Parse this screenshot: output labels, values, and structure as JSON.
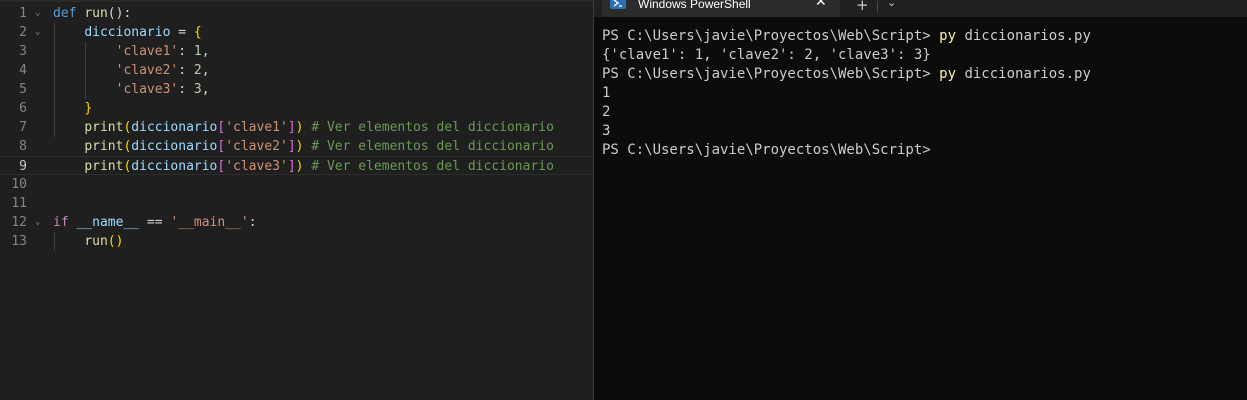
{
  "editor": {
    "lines": [
      {
        "n": "1",
        "t": [
          [
            "kw",
            "def "
          ],
          [
            "fn",
            "run"
          ],
          [
            "pn",
            "():"
          ]
        ]
      },
      {
        "n": "2",
        "t": [
          [
            "pn",
            "    "
          ],
          [
            "var",
            "diccionario"
          ],
          [
            "pn",
            " = "
          ],
          [
            "b1",
            "{"
          ]
        ]
      },
      {
        "n": "3",
        "t": [
          [
            "pn",
            "        "
          ],
          [
            "str",
            "'clave1'"
          ],
          [
            "pn",
            ": "
          ],
          [
            "num",
            "1"
          ],
          [
            "pn",
            ","
          ]
        ]
      },
      {
        "n": "4",
        "t": [
          [
            "pn",
            "        "
          ],
          [
            "str",
            "'clave2'"
          ],
          [
            "pn",
            ": "
          ],
          [
            "num",
            "2"
          ],
          [
            "pn",
            ","
          ]
        ]
      },
      {
        "n": "5",
        "t": [
          [
            "pn",
            "        "
          ],
          [
            "str",
            "'clave3'"
          ],
          [
            "pn",
            ": "
          ],
          [
            "num",
            "3"
          ],
          [
            "pn",
            ","
          ]
        ]
      },
      {
        "n": "6",
        "t": [
          [
            "pn",
            "    "
          ],
          [
            "b1",
            "}"
          ]
        ]
      },
      {
        "n": "7",
        "t": [
          [
            "pn",
            "    "
          ],
          [
            "fn",
            "print"
          ],
          [
            "b1",
            "("
          ],
          [
            "var",
            "diccionario"
          ],
          [
            "b2",
            "["
          ],
          [
            "str",
            "'clave1'"
          ],
          [
            "b2",
            "]"
          ],
          [
            "b1",
            ")"
          ],
          [
            "pn",
            " "
          ],
          [
            "cm",
            "# Ver elementos del diccionario"
          ]
        ]
      },
      {
        "n": "8",
        "t": [
          [
            "pn",
            "    "
          ],
          [
            "fn",
            "print"
          ],
          [
            "b1",
            "("
          ],
          [
            "var",
            "diccionario"
          ],
          [
            "b2",
            "["
          ],
          [
            "str",
            "'clave2'"
          ],
          [
            "b2",
            "]"
          ],
          [
            "b1",
            ")"
          ],
          [
            "pn",
            " "
          ],
          [
            "cm",
            "# Ver elementos del diccionario"
          ]
        ]
      },
      {
        "n": "9",
        "t": [
          [
            "pn",
            "    "
          ],
          [
            "fn",
            "print"
          ],
          [
            "b1",
            "("
          ],
          [
            "var",
            "diccionario"
          ],
          [
            "b2",
            "["
          ],
          [
            "str",
            "'clave3'"
          ],
          [
            "b2",
            "]"
          ],
          [
            "b1",
            ")"
          ],
          [
            "pn",
            " "
          ],
          [
            "cm",
            "# Ver elementos del diccionario"
          ]
        ]
      },
      {
        "n": "10",
        "t": []
      },
      {
        "n": "11",
        "t": []
      },
      {
        "n": "12",
        "t": [
          [
            "kw2",
            "if "
          ],
          [
            "var",
            "__name__"
          ],
          [
            "pn",
            " == "
          ],
          [
            "str",
            "'__main__'"
          ],
          [
            "pn",
            ":"
          ]
        ]
      },
      {
        "n": "13",
        "t": [
          [
            "pn",
            "    "
          ],
          [
            "fn",
            "run"
          ],
          [
            "b1",
            "()"
          ]
        ]
      }
    ],
    "active_line": "9"
  },
  "terminal": {
    "tab_title": "Windows PowerShell",
    "close_glyph": "✕",
    "new_tab_glyph": "+",
    "dropdown_glyph": "⌄",
    "lines": [
      {
        "prompt": "PS C:\\Users\\javie\\Proyectos\\Web\\Script> ",
        "cmd": "py",
        "rest": " diccionarios.py"
      },
      {
        "prompt": "{'clave1': 1, 'clave2': 2, 'clave3': 3}",
        "cmd": "",
        "rest": ""
      },
      {
        "prompt": "PS C:\\Users\\javie\\Proyectos\\Web\\Script> ",
        "cmd": "py",
        "rest": " diccionarios.py"
      },
      {
        "prompt": "1",
        "cmd": "",
        "rest": ""
      },
      {
        "prompt": "2",
        "cmd": "",
        "rest": ""
      },
      {
        "prompt": "3",
        "cmd": "",
        "rest": ""
      },
      {
        "prompt": "PS C:\\Users\\javie\\Proyectos\\Web\\Script>",
        "cmd": "",
        "rest": ""
      }
    ]
  }
}
